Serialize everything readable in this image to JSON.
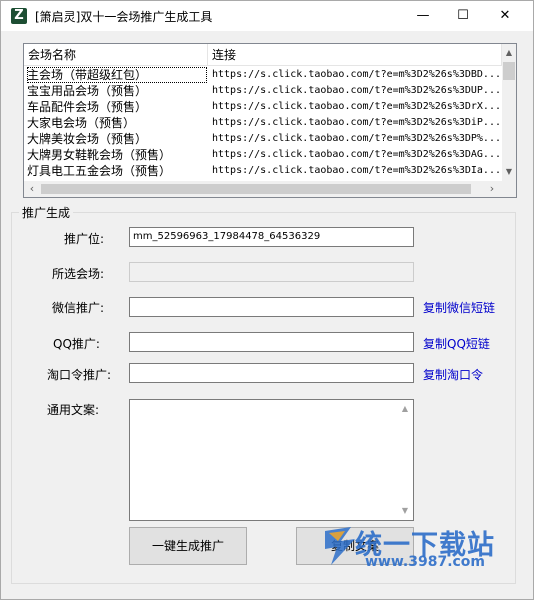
{
  "window": {
    "icon_letter": "Z",
    "title": "[箫启灵]双十一会场推广生成工具",
    "minimize": "—",
    "maximize": "☐",
    "close": "✕"
  },
  "list": {
    "columns": [
      "会场名称",
      "连接"
    ],
    "rows": [
      {
        "name": "主会场（带超级红包）",
        "link": "https://s.click.taobao.com/t?e=m%3D2%26s%3DBD..."
      },
      {
        "name": "宝宝用品会场（预售）",
        "link": "https://s.click.taobao.com/t?e=m%3D2%26s%3DUP..."
      },
      {
        "name": "车品配件会场（预售）",
        "link": "https://s.click.taobao.com/t?e=m%3D2%26s%3DrX..."
      },
      {
        "name": "大家电会场（预售）",
        "link": "https://s.click.taobao.com/t?e=m%3D2%26s%3DiP..."
      },
      {
        "name": "大牌美妆会场（预售）",
        "link": "https://s.click.taobao.com/t?e=m%3D2%26s%3DP%..."
      },
      {
        "name": "大牌男女鞋靴会场（预售）",
        "link": "https://s.click.taobao.com/t?e=m%3D2%26s%3DAG..."
      },
      {
        "name": "灯具电工五金会场（预售）",
        "link": "https://s.click.taobao.com/t?e=m%3D2%26s%3DIa..."
      }
    ]
  },
  "form": {
    "group_title": "推广生成",
    "pid_label": "推广位:",
    "pid_value": "mm_52596963_17984478_64536329",
    "venue_label": "所选会场:",
    "venue_value": "",
    "wechat_label": "微信推广:",
    "wechat_value": "",
    "wechat_link": "复制微信短链",
    "qq_label": "QQ推广:",
    "qq_value": "",
    "qq_link": "复制QQ短链",
    "tkl_label": "淘口令推广:",
    "tkl_value": "",
    "tkl_link": "复制淘口令",
    "copy_label": "通用文案:",
    "copy_value": ""
  },
  "buttons": {
    "generate": "一键生成推广",
    "copy_text": "复制文案"
  },
  "watermark": {
    "text": "统一下载站",
    "url": "www.3987.com"
  },
  "colors": {
    "link": "#0000cc",
    "watermark": "#2d6ec9"
  }
}
